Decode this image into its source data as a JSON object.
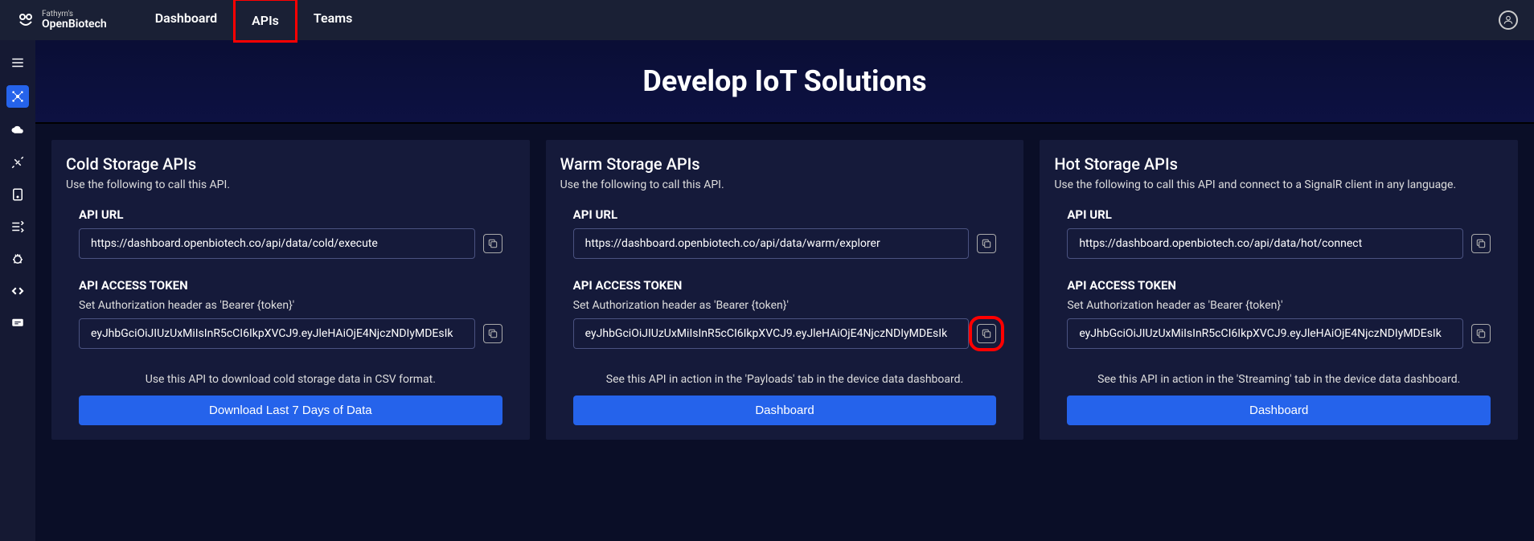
{
  "brand": {
    "small": "Fathym's",
    "big": "OpenBiotech"
  },
  "nav": {
    "dashboard": "Dashboard",
    "apis": "APIs",
    "teams": "Teams"
  },
  "hero": {
    "title": "Develop IoT Solutions"
  },
  "labels": {
    "apiUrl": "API URL",
    "apiToken": "API ACCESS TOKEN",
    "tokenHint": "Set Authorization header as 'Bearer {token}'"
  },
  "cards": {
    "cold": {
      "title": "Cold Storage APIs",
      "subtitle": "Use the following to call this API.",
      "url": "https://dashboard.openbiotech.co/api/data/cold/execute",
      "token": "eyJhbGciOiJIUzUxMiIsInR5cCI6IkpXVCJ9.eyJleHAiOjE4NjczNDIyMDEsIk",
      "desc": "Use this API to download cold storage data in CSV format.",
      "button": "Download Last 7 Days of Data"
    },
    "warm": {
      "title": "Warm Storage APIs",
      "subtitle": "Use the following to call this API.",
      "url": "https://dashboard.openbiotech.co/api/data/warm/explorer",
      "token": "eyJhbGciOiJIUzUxMiIsInR5cCI6IkpXVCJ9.eyJleHAiOjE4NjczNDIyMDEsIk",
      "desc": "See this API in action in the 'Payloads' tab in the device data dashboard.",
      "button": "Dashboard"
    },
    "hot": {
      "title": "Hot Storage APIs",
      "subtitle": "Use the following to call this API and connect to a SignalR client in any language.",
      "url": "https://dashboard.openbiotech.co/api/data/hot/connect",
      "token": "eyJhbGciOiJIUzUxMiIsInR5cCI6IkpXVCJ9.eyJleHAiOjE4NjczNDIyMDEsIk",
      "desc": "See this API in action in the 'Streaming' tab in the device data dashboard.",
      "button": "Dashboard"
    }
  }
}
